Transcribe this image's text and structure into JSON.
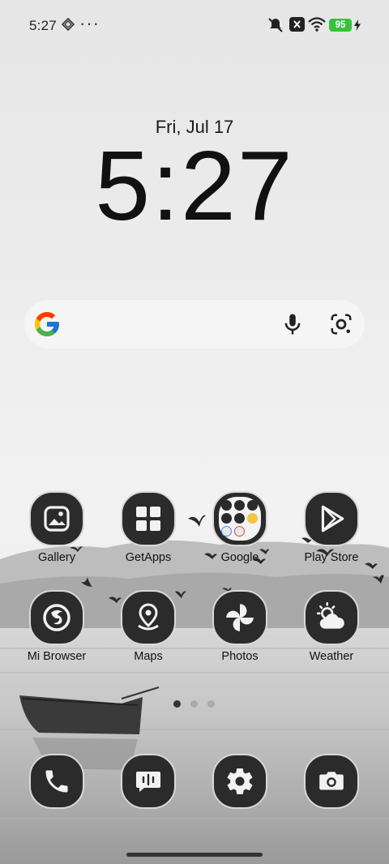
{
  "status_bar": {
    "time": "5:27",
    "overflow": "···",
    "battery": "95",
    "icons": [
      "widget-gem-icon",
      "mute-icon",
      "no-sim-icon",
      "wifi-icon",
      "battery-icon",
      "charging-icon"
    ]
  },
  "clock_widget": {
    "date": "Fri, Jul 17",
    "time": "5:27"
  },
  "search_bar": {
    "icons": [
      "google-logo-icon",
      "microphone-icon",
      "lens-camera-icon"
    ]
  },
  "apps_row1": [
    {
      "label": "Gallery",
      "icon": "gallery-icon"
    },
    {
      "label": "GetApps",
      "icon": "getapps-icon"
    },
    {
      "label": "Google",
      "icon": "google-folder-icon"
    },
    {
      "label": "Play Store",
      "icon": "play-store-icon"
    }
  ],
  "apps_row2": [
    {
      "label": "Mi Browser",
      "icon": "browser-icon"
    },
    {
      "label": "Maps",
      "icon": "maps-icon"
    },
    {
      "label": "Photos",
      "icon": "photos-icon"
    },
    {
      "label": "Weather",
      "icon": "weather-icon"
    }
  ],
  "dock": [
    {
      "name": "phone",
      "icon": "phone-icon"
    },
    {
      "name": "messages",
      "icon": "messages-icon"
    },
    {
      "name": "settings",
      "icon": "settings-icon"
    },
    {
      "name": "camera",
      "icon": "camera-icon"
    }
  ],
  "page_indicator": {
    "count": 3,
    "active": 0
  },
  "colors": {
    "icon_background": "#2b2b2b",
    "battery": "#36c23f",
    "text": "#111111"
  }
}
